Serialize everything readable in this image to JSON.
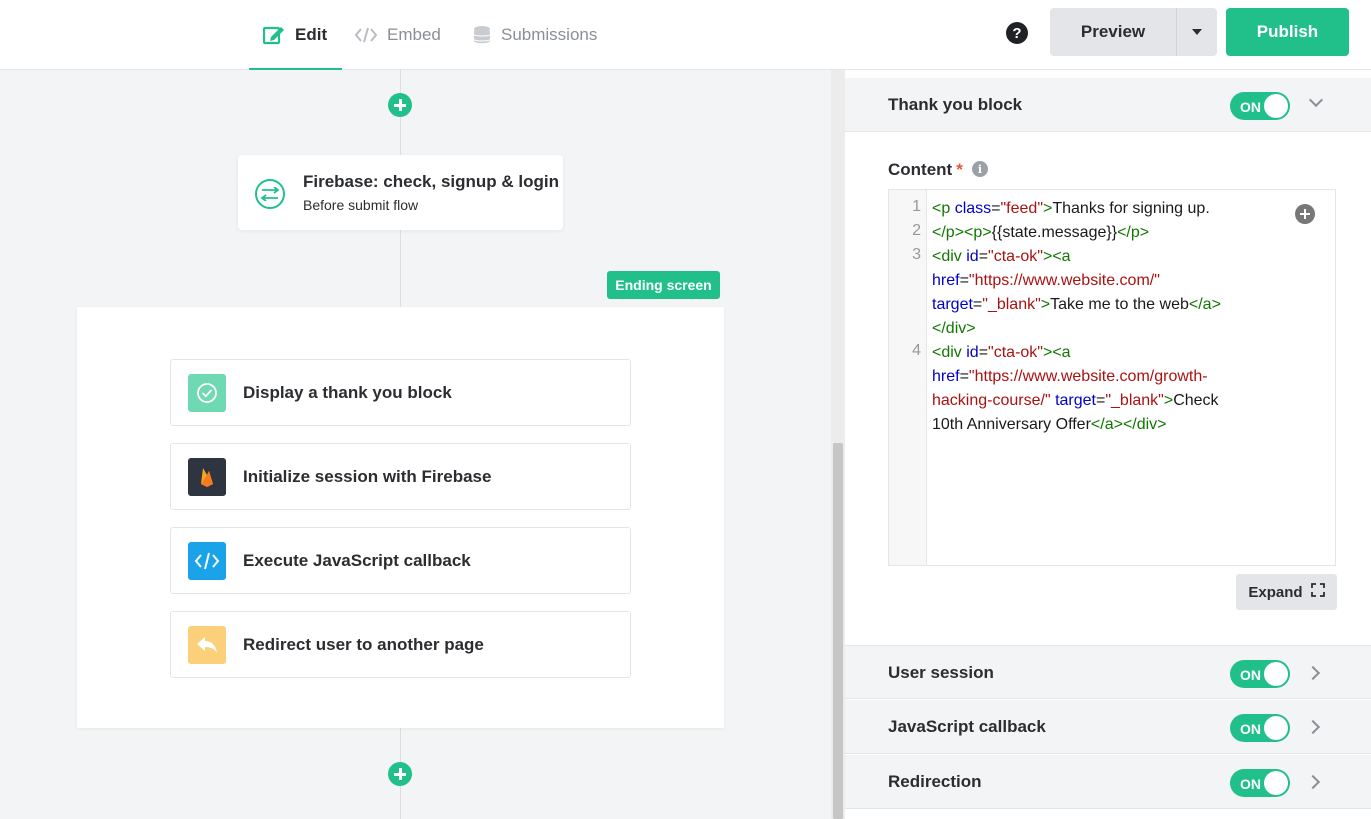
{
  "header": {
    "tabs": [
      {
        "label": "Edit",
        "icon": "edit-icon",
        "active": true
      },
      {
        "label": "Embed",
        "icon": "code-icon",
        "active": false
      },
      {
        "label": "Submissions",
        "icon": "database-icon",
        "active": false
      }
    ],
    "help_glyph": "?",
    "preview_label": "Preview",
    "publish_label": "Publish"
  },
  "canvas": {
    "flow_card": {
      "title": "Firebase: check, signup & login",
      "subtitle": "Before submit flow"
    },
    "ending_badge": "Ending screen",
    "actions": [
      {
        "label": "Display a thank you block",
        "icon": "check-circle-icon",
        "color": "#6fd9b4"
      },
      {
        "label": "Initialize session with Firebase",
        "icon": "firebase-icon",
        "color": "#2e3440"
      },
      {
        "label": "Execute JavaScript callback",
        "icon": "code-icon",
        "color": "#1aa3e8"
      },
      {
        "label": "Redirect user to another page",
        "icon": "reply-arrow-icon",
        "color": "#fcd07a"
      }
    ]
  },
  "settings": {
    "sections": [
      {
        "title": "Thank you block",
        "toggle": "ON",
        "expanded": true
      },
      {
        "title": "User session",
        "toggle": "ON",
        "expanded": false
      },
      {
        "title": "JavaScript callback",
        "toggle": "ON",
        "expanded": false
      },
      {
        "title": "Redirection",
        "toggle": "ON",
        "expanded": false
      }
    ],
    "content_label": "Content",
    "required_mark": "*",
    "line_numbers": [
      "1",
      "2",
      "3",
      "4"
    ],
    "code": {
      "l1a_open": "<p",
      "l1a_attr": "class",
      "l1a_eq": "=",
      "l1a_val": "\"feed\"",
      "l1a_close": ">",
      "l1a_text": "Thanks for signing up.",
      "l1b_close_p": "</p>",
      "l1b_open_p": "<p>",
      "l1b_text": "{{state.message}}",
      "l1b_end_p": "</p>",
      "l3_div": "<div",
      "l3_id": "id",
      "l3_id_val": "\"cta-ok\"",
      "l3_gt_a": "><a",
      "l3_href": "href",
      "l3_href_val": "\"https://www.website.com/\"",
      "l3_target": "target",
      "l3_target_val": "\"_blank\"",
      "l3_text": "Take me to the web",
      "l3_end_a": "</a>",
      "l3_end_div": "</div>",
      "l4_div": "<div",
      "l4_id": "id",
      "l4_id_val": "\"cta-ok\"",
      "l4_gt_a": "><a",
      "l4_href": "href",
      "l4_href_val_a": "\"https://www.website.com/growth-",
      "l4_href_val_b": "hacking-course/\"",
      "l4_target": "target",
      "l4_target_val": "\"_blank\"",
      "l4_text_a": "Check",
      "l4_text_b": "10th Anniversary Offer",
      "l4_end": "</a></div>"
    },
    "expand_label": "Expand"
  },
  "colors": {
    "accent": "#21c08b",
    "panel_bg": "#f3f4f5",
    "text": "#2b2d30"
  }
}
